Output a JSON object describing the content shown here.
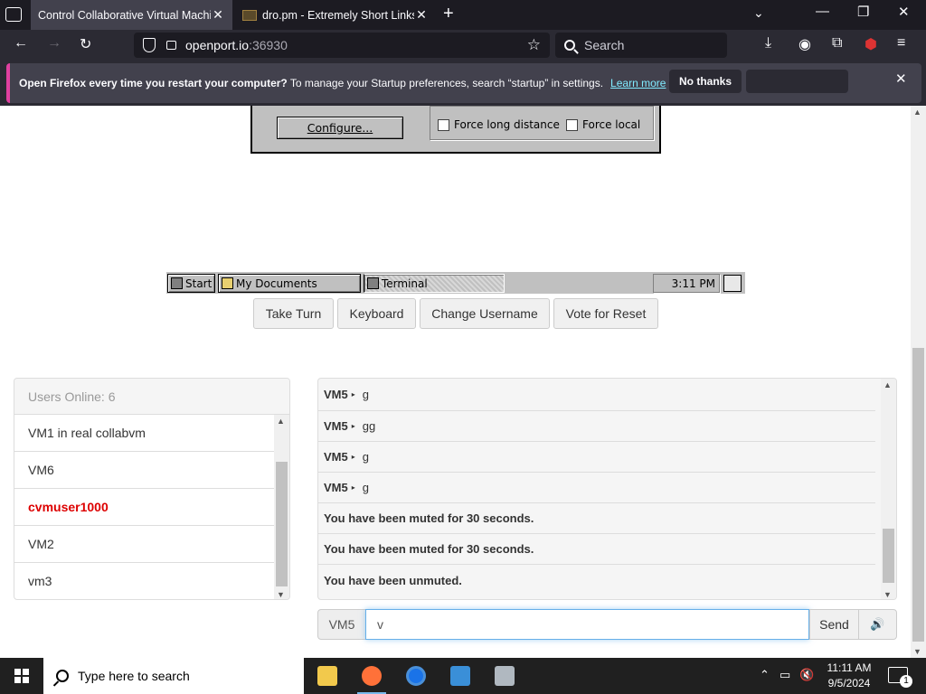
{
  "browser": {
    "tabs": [
      {
        "title": "Control Collaborative Virtual Machines",
        "active": true
      },
      {
        "title": "dro.pm - Extremely Short Links",
        "active": false
      }
    ],
    "url_host": "openport.io",
    "url_port": ":36930",
    "search_placeholder": "Search",
    "notification": {
      "bold": "Open Firefox every time you restart your computer?",
      "text": " To manage your Startup preferences, search “startup” in settings.",
      "link": "Learn more",
      "button": "No thanks"
    }
  },
  "vm": {
    "configure": "Configure...",
    "force_long_distance": "Force long distance",
    "force_local": "Force local",
    "taskbar": {
      "start": "Start",
      "my_documents": "My Documents",
      "terminal": "Terminal",
      "clock": "3:11 PM"
    }
  },
  "controls": {
    "take_turn": "Take Turn",
    "keyboard": "Keyboard",
    "change_username": "Change Username",
    "vote_reset": "Vote for Reset"
  },
  "users": {
    "header": "Users Online: 6",
    "list": [
      "VM1 in real collabvm",
      "VM6",
      "cvmuser1000",
      "VM2",
      "vm3"
    ]
  },
  "chat": {
    "messages": [
      {
        "user": "VM5",
        "text": "g"
      },
      {
        "user": "VM5",
        "text": "gg"
      },
      {
        "user": "VM5",
        "text": "g"
      },
      {
        "user": "VM5",
        "text": "g"
      }
    ],
    "system": [
      "You have been muted for 30 seconds.",
      "You have been muted for 30 seconds.",
      "You have been unmuted."
    ],
    "username": "VM5",
    "input_value": "v",
    "send": "Send"
  },
  "windows": {
    "search_placeholder": "Type here to search",
    "time": "11:11 AM",
    "date": "9/5/2024",
    "notifications": "1"
  }
}
